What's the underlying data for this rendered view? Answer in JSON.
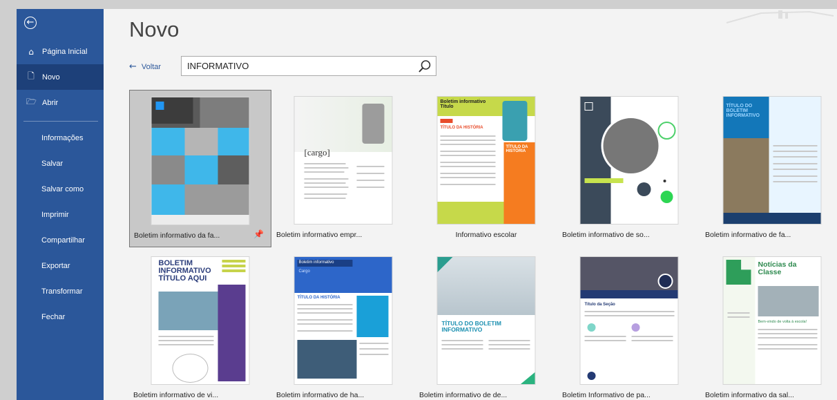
{
  "sidebar": {
    "back_icon": "back-arrow-icon",
    "items": [
      {
        "label": "Página Inicial",
        "icon": "home-icon"
      },
      {
        "label": "Novo",
        "icon": "new-document-icon"
      },
      {
        "label": "Abrir",
        "icon": "open-folder-icon"
      }
    ],
    "commands": [
      "Informações",
      "Salvar",
      "Salvar como",
      "Imprimir",
      "Compartilhar",
      "Exportar",
      "Transformar",
      "Fechar"
    ],
    "accent": "#2b579a",
    "selected_bg": "#1d4079"
  },
  "page": {
    "title": "Novo",
    "back_label": "Voltar",
    "search": {
      "value": "INFORMATIVO",
      "icon": "search-icon"
    }
  },
  "templates": [
    {
      "label": "Boletim informativo da fa...",
      "selected": true,
      "pinned": true
    },
    {
      "label": "Boletim informativo empr...",
      "thumb_text": "[cargo]"
    },
    {
      "label": "Informativo escolar",
      "thumb_text": [
        "Boletim informativo",
        "Título",
        "TÍTULO DA HISTÓRIA",
        "TÍTULO DA HISTÓRIA"
      ]
    },
    {
      "label": "Boletim informativo de so..."
    },
    {
      "label": "Boletim informativo de fa...",
      "thumb_text": "TÍTULO DO BOLETIM INFORMATIVO"
    },
    {
      "label": "Boletim informativo de vi...",
      "thumb_text": [
        "BOLETIM",
        "INFORMATIVO",
        "TÍTULO AQUI"
      ]
    },
    {
      "label": "Boletim informativo de ha...",
      "thumb_text": [
        "Boletim informativo",
        "Cargo",
        "TÍTULO DA HISTÓRIA"
      ]
    },
    {
      "label": "Boletim informativo de de...",
      "thumb_text": [
        "TÍTULO DO BOLETIM",
        "INFORMATIVO"
      ]
    },
    {
      "label": "Boletim Informativo de pa...",
      "thumb_text": "Título da Seção"
    },
    {
      "label": "Boletim informativo da sal...",
      "thumb_text": [
        "Notícias da",
        "Classe",
        "Bem-vindo de volta à escola!"
      ]
    }
  ]
}
